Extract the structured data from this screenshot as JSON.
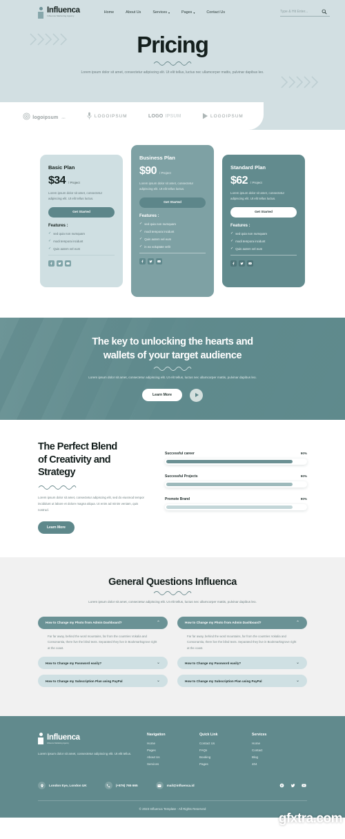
{
  "header": {
    "logo_name": "Influenca",
    "logo_tagline": "Influence Marketing Agency",
    "nav": [
      {
        "label": "Home",
        "caret": false
      },
      {
        "label": "About Us",
        "caret": false
      },
      {
        "label": "Services",
        "caret": true
      },
      {
        "label": "Pages",
        "caret": true
      },
      {
        "label": "Contact Us",
        "caret": false
      }
    ],
    "search_placeholder": "Type & Hit Enter...",
    "search_value": ""
  },
  "hero": {
    "title": "Pricing",
    "desc": "Lorem ipsum dolor sit amet, consectetur adipiscing elit. Ut elit tellus, luctus nec ullamcorper mattis, pulvinar dapibus leo."
  },
  "brands": [
    {
      "name": "logoipsum",
      "sub": ".com",
      "style": "bold"
    },
    {
      "name": "LOGOIPSUM",
      "sub": "",
      "style": "thin"
    },
    {
      "name": "LOGO",
      "sub": "IPSUM",
      "style": "bold"
    },
    {
      "name": "LOGOIPSUM",
      "sub": "",
      "style": "thin"
    }
  ],
  "pricing": {
    "plans": [
      {
        "name": "Basic Plan",
        "price": "$34",
        "per": "/ Project",
        "desc": "Lorem ipsum dolor sit amet, consectetur adipiscing elit. Ut elit tellus luctus.",
        "cta": "Get Started",
        "features_label": "Features :",
        "features": [
          "sed quia non numquam",
          "modi tempora incidunt",
          "Quis autem vel eum"
        ],
        "socials": [
          "facebook-icon",
          "twitter-icon",
          "youtube-icon"
        ]
      },
      {
        "name": "Business Plan",
        "price": "$90",
        "per": "/ Project",
        "desc": "Lorem ipsum dolor sit amet, consectetur adipiscing elit. Ut elit tellus luctus.",
        "cta": "Get Started",
        "features_label": "Features :",
        "features": [
          "sed quia non numquam",
          "modi tempora incidunt",
          "Quis autem vel eum",
          "in ea voluptate velit"
        ],
        "socials": [
          "facebook-icon",
          "twitter-icon",
          "youtube-icon"
        ]
      },
      {
        "name": "Standard Plan",
        "price": "$62",
        "per": "/ Project",
        "desc": "Lorem ipsum dolor sit amet, consectetur adipiscing elit. Ut elit tellus luctus.",
        "cta": "Get Started",
        "features_label": "Features :",
        "features": [
          "sed quia non numquam",
          "modi tempora incidunt",
          "Quis autem vel eum"
        ],
        "socials": [
          "facebook-icon",
          "twitter-icon",
          "youtube-icon"
        ]
      }
    ]
  },
  "cta": {
    "title_line1": "The key to unlocking the hearts and",
    "title_line2": "wallets of your target audience",
    "desc": "Lorem ipsum dolor sit amet, consectetur adipiscing elit. Ut elit tellus, luctus nec ullamcorper mattis, pulvinar dapibus leo.",
    "button": "Learn More",
    "play": "play-icon"
  },
  "blend": {
    "title_line1": "The Perfect Blend",
    "title_line2": "of Creativity and",
    "title_line3": "Strategy",
    "desc": "Lorem ipsum dolor sit amet, consectetur adipiscing elit, sed do eiusmod tempor incididunt ut labore et dolore magna aliqua. Ut enim ad minim veniam, quis nostrud.",
    "button": "Learn More",
    "skills": [
      {
        "name": "Successful career",
        "pct": "90%",
        "value": 90
      },
      {
        "name": "Successful Projects",
        "pct": "90%",
        "value": 90
      },
      {
        "name": "Promote Brand",
        "pct": "90%",
        "value": 90
      }
    ]
  },
  "faq": {
    "title": "General Questions Influenca",
    "desc": "Lorem ipsum dolor sit amet, consectetur adipiscing elit. Ut elit tellus, luctus nec ullamcorper mattis, pulvinar dapibus leo.",
    "answer": "Far far away, behind the word mountains, far from the countries Vokalia and Consonantia, there live the blind texts. Separated they live in Bookmarksgrove right at the coast.",
    "left": [
      {
        "q": "How to Change my Photo from Admin Dashboard?",
        "open": true
      },
      {
        "q": "How to Change my Password easily?",
        "open": false
      },
      {
        "q": "How to Change my Subscription Plan using PayPal",
        "open": false
      }
    ],
    "right": [
      {
        "q": "How to Change my Photo from Admin Dashboard?",
        "open": true
      },
      {
        "q": "How to Change my Password easily?",
        "open": false
      },
      {
        "q": "How to Change my Subscription Plan using PayPal",
        "open": false
      }
    ]
  },
  "footer": {
    "logo_name": "Influenca",
    "logo_tagline": "Influence Marketing Agency",
    "desc": "Lorem ipsum dolor sit amet, consectetur adipiscing elit. Ut elit tellus.",
    "columns": [
      {
        "title": "Navigation",
        "links": [
          "Home",
          "Pages",
          "About Us",
          "Services"
        ]
      },
      {
        "title": "Quick Link",
        "links": [
          "Contact Us",
          "FAQs",
          "Booking",
          "Pages"
        ]
      },
      {
        "title": "Services",
        "links": [
          "Home",
          "Contact",
          "Blog",
          "404"
        ]
      }
    ],
    "address": "London Eye, London UK",
    "phone": "(+876) 765 665",
    "email": "mail@influenca.id",
    "socials": [
      "facebook-icon",
      "twitter-icon",
      "youtube-icon"
    ],
    "copyright": "© 2023 Influenca Template - All Rights Reserved"
  },
  "watermark": "gfxtra.com",
  "colors": {
    "hero_bg": "#d2dfe2",
    "accent": "#5f8a8d",
    "card_basic": "#cfdfe2",
    "card_business": "#7ea1a4",
    "card_standard": "#628b8e",
    "faq_bg": "#f1f1f1"
  }
}
